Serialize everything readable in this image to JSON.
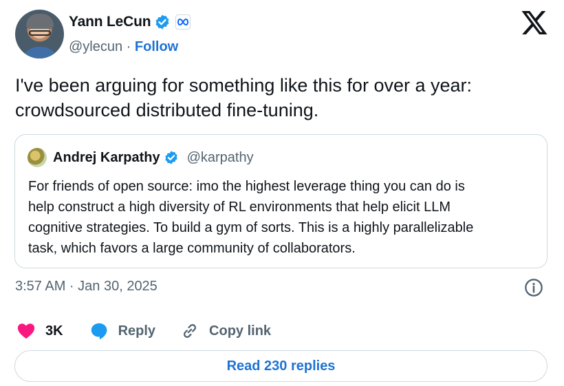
{
  "author": {
    "display_name": "Yann LeCun",
    "handle": "@ylecun",
    "separator": " · ",
    "follow_label": "Follow",
    "avatar_icon": "profile-photo",
    "affiliate_icon": "meta-logo-icon"
  },
  "tweet": {
    "lines": [
      "I've been arguing for something like this for over a year:",
      "crowdsourced distributed fine-tuning."
    ]
  },
  "quote": {
    "display_name": "Andrej Karpathy",
    "handle": "@karpathy",
    "lines": [
      "For friends of open source: imo the highest leverage thing you can do is",
      "help construct a high diversity of RL environments that help elicit LLM",
      "cognitive strategies. To build a gym of sorts. This is a highly parallelizable",
      "task, which favors a large community of collaborators."
    ]
  },
  "timestamp": "3:57 AM · Jan 30, 2025",
  "actions": {
    "like_count": "3K",
    "reply_label": "Reply",
    "copy_label": "Copy link"
  },
  "read_replies_label": "Read 230 replies",
  "colors": {
    "accent": "#1d72d4",
    "like": "#f91880",
    "verified": "#1d9bf0",
    "muted": "#536471",
    "border": "#cfd9de"
  }
}
